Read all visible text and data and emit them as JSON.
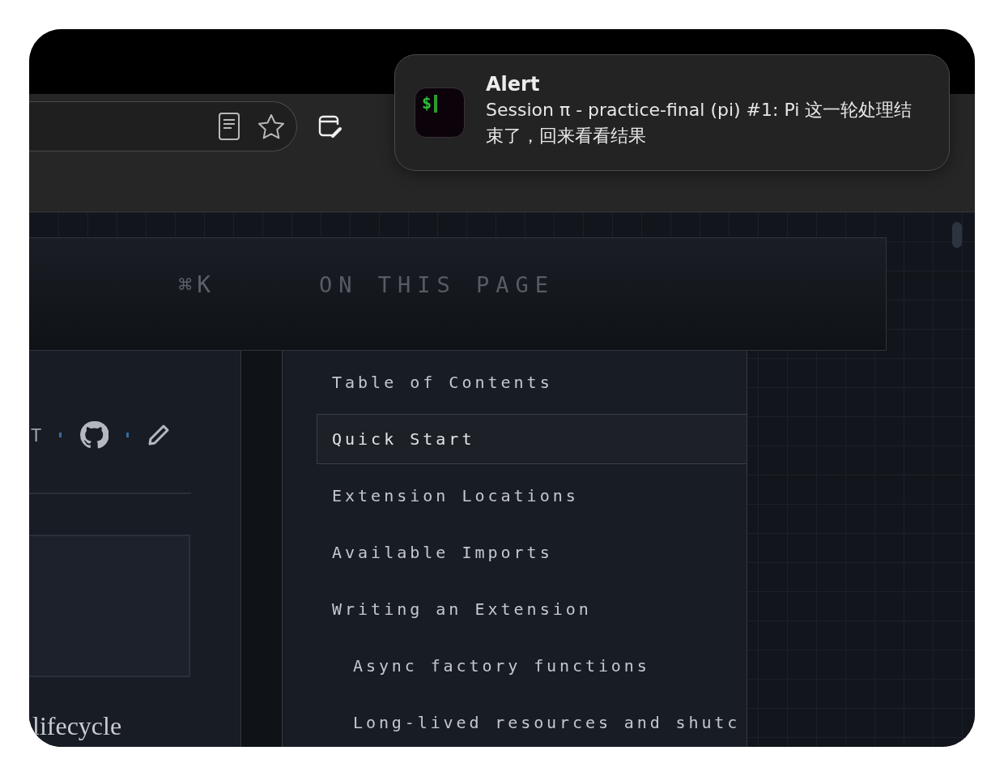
{
  "notification": {
    "app_icon_text": "$",
    "title": "Alert",
    "body": "Session π - practice-final (pi) #1: Pi 这一轮处理结束了，回来看看结果"
  },
  "header": {
    "search_shortcut": "⌘K",
    "section_label": "ON THIS PAGE"
  },
  "article": {
    "meta_text": "T",
    "heading": "lifecycle"
  },
  "toc": {
    "items": [
      {
        "label": "Table of Contents",
        "selected": false
      },
      {
        "label": "Quick Start",
        "selected": true
      },
      {
        "label": "Extension Locations",
        "selected": false
      },
      {
        "label": "Available Imports",
        "selected": false
      },
      {
        "label": "Writing an Extension",
        "selected": false,
        "children": [
          {
            "label": "Async factory functions",
            "selected": false
          },
          {
            "label": "Long-lived resources and shutc",
            "selected": false
          }
        ]
      }
    ]
  }
}
